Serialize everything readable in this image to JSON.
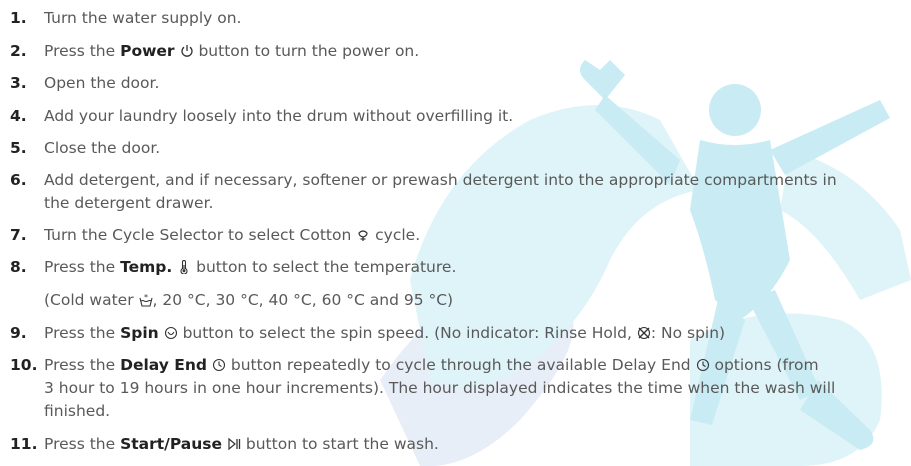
{
  "colors": {
    "text": "#595959",
    "number": "#222222",
    "watermark": "#dff4f8",
    "watermark_figure": "#c9ebf3",
    "watermark_blue": "#e6ecf7"
  },
  "steps": [
    {
      "number": "1.",
      "text": "Turn the water supply on."
    },
    {
      "number": "2.",
      "pre": "Press the ",
      "bold": "Power",
      "icon": "power-icon",
      "post": " button to turn the power on."
    },
    {
      "number": "3.",
      "text": "Open the door."
    },
    {
      "number": "4.",
      "text": "Add your laundry loosely into the drum without overfilling it."
    },
    {
      "number": "5.",
      "text": "Close the door."
    },
    {
      "number": "6.",
      "line1": "Add detergent, and if necessary, softener or prewash detergent into the appropriate compartments in",
      "line2": "the detergent drawer."
    },
    {
      "number": "7.",
      "pre": "Turn the Cycle Selector to select Cotton ",
      "icon": "cotton-icon",
      "post": " cycle."
    },
    {
      "number": "8.",
      "pre": "Press the ",
      "bold": "Temp.",
      "icon": "thermometer-icon",
      "post": " button to select the temperature.",
      "sub_pre": "(Cold water ",
      "sub_icon": "cold-water-icon",
      "sub_post": ", 20 °C, 30 °C, 40 °C, 60 °C and 95 °C)"
    },
    {
      "number": "9.",
      "pre": "Press the ",
      "bold": "Spin",
      "icon": "spin-icon",
      "mid": " button to select the spin speed. (No indicator: Rinse Hold, ",
      "icon2": "no-spin-icon",
      "post": ": No spin)"
    },
    {
      "number": "10.",
      "pre": "Press the ",
      "bold": "Delay End",
      "icon": "delay-end-icon",
      "mid": " button repeatedly to cycle through the available Delay End ",
      "icon2": "delay-end-icon",
      "post": " options (from",
      "line2": "3 hour to 19 hours in one hour increments). The hour displayed indicates the time when the wash will",
      "line3": "finished."
    },
    {
      "number": "11.",
      "pre": "Press the ",
      "bold": "Start/Pause",
      "icon": "start-pause-icon",
      "post": " button to start the wash."
    }
  ]
}
